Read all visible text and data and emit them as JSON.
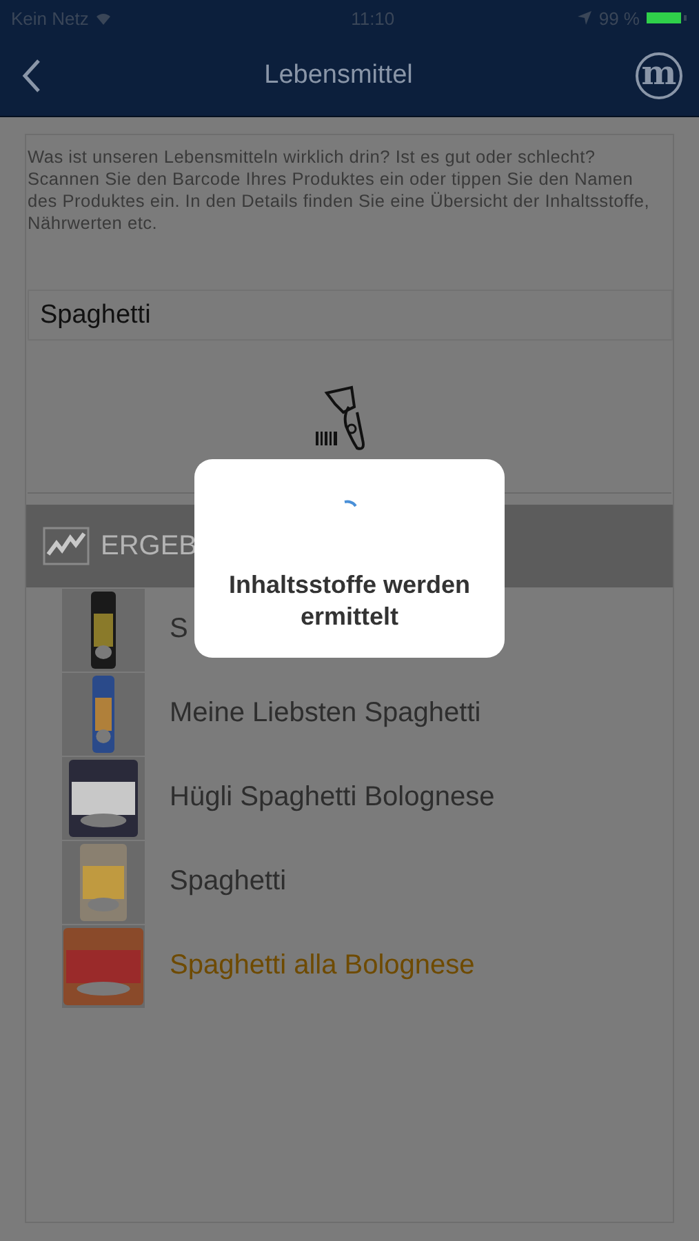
{
  "status_bar": {
    "carrier": "Kein Netz",
    "time": "11:10",
    "battery": "99 %"
  },
  "nav": {
    "title": "Lebensmittel",
    "logo": "m"
  },
  "intro": "Was ist unseren Lebensmitteln wirklich drin? Ist es gut oder schlecht? Scannen Sie den Barcode Ihres Produktes ein oder tippen Sie den Namen des Produktes ein. In den Details finden Sie eine Übersicht der Inhaltsstoffe, Nährwerten etc.",
  "search": {
    "value": "Spaghetti"
  },
  "results": {
    "header": "ERGEB",
    "items": [
      {
        "name": "S",
        "selected": false
      },
      {
        "name": "Meine Liebsten Spaghetti",
        "selected": false
      },
      {
        "name": "Hügli Spaghetti Bolognese",
        "selected": false
      },
      {
        "name": "Spaghetti",
        "selected": false
      },
      {
        "name": "Spaghetti alla Bolognese",
        "selected": true
      }
    ]
  },
  "dialog": {
    "message": "Inhaltsstoffe werden ermittelt"
  }
}
